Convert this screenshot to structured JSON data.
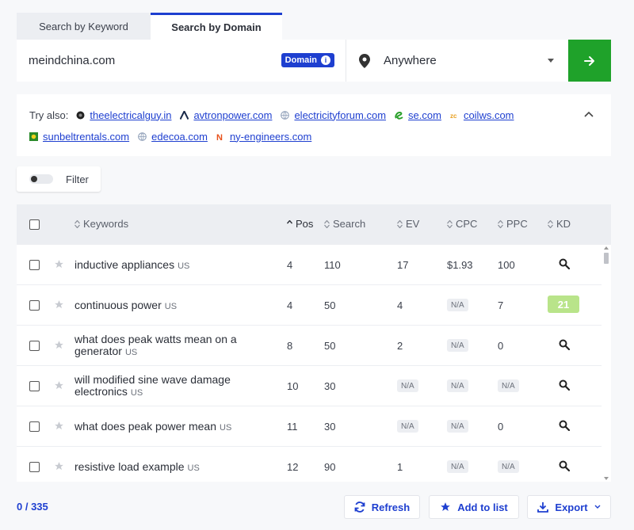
{
  "tabs": [
    {
      "label": "Search by Keyword",
      "active": false
    },
    {
      "label": "Search by Domain",
      "active": true
    }
  ],
  "search": {
    "domain_value": "meindchina.com",
    "badge_label": "Domain",
    "location_value": "Anywhere"
  },
  "try_also": {
    "label": "Try also:",
    "domains": [
      {
        "name": "theelectricalguy.in",
        "icon": "dark-globe-icon"
      },
      {
        "name": "avtronpower.com",
        "icon": "avtron-logo-icon"
      },
      {
        "name": "electricityforum.com",
        "icon": "globe-icon"
      },
      {
        "name": "se.com",
        "icon": "se-logo-icon"
      },
      {
        "name": "coilws.com",
        "icon": "coilws-logo-icon"
      },
      {
        "name": "sunbeltrentals.com",
        "icon": "sunbelt-logo-icon"
      },
      {
        "name": "edecoa.com",
        "icon": "globe-icon"
      },
      {
        "name": "ny-engineers.com",
        "icon": "ny-engineers-logo-icon"
      }
    ]
  },
  "filter": {
    "label": "Filter"
  },
  "table": {
    "headers": {
      "keywords": "Keywords",
      "pos": "Pos",
      "search": "Search",
      "ev": "EV",
      "cpc": "CPC",
      "ppc": "PPC",
      "kd": "KD"
    },
    "rows": [
      {
        "kw1": "inductive appliances",
        "kw2": "",
        "loc": "US",
        "pos": "4",
        "search": "110",
        "ev": "17",
        "cpc": "$1.93",
        "ppc": "100",
        "kd": ""
      },
      {
        "kw1": "continuous power",
        "kw2": "",
        "loc": "US",
        "pos": "4",
        "search": "50",
        "ev": "4",
        "cpc": "N/A",
        "ppc": "7",
        "kd": "21"
      },
      {
        "kw1": "what does peak watts mean on a",
        "kw2": "generator",
        "loc": "US",
        "pos": "8",
        "search": "50",
        "ev": "2",
        "cpc": "N/A",
        "ppc": "0",
        "kd": ""
      },
      {
        "kw1": "will modified sine wave damage",
        "kw2": "electronics",
        "loc": "US",
        "pos": "10",
        "search": "30",
        "ev": "N/A",
        "cpc": "N/A",
        "ppc": "N/A",
        "kd": ""
      },
      {
        "kw1": "what does peak power mean",
        "kw2": "",
        "loc": "US",
        "pos": "11",
        "search": "30",
        "ev": "N/A",
        "cpc": "N/A",
        "ppc": "0",
        "kd": ""
      },
      {
        "kw1": "resistive load example",
        "kw2": "",
        "loc": "US",
        "pos": "12",
        "search": "90",
        "ev": "1",
        "cpc": "N/A",
        "ppc": "N/A",
        "kd": ""
      }
    ]
  },
  "footer": {
    "count": "0 / 335",
    "refresh_label": "Refresh",
    "add_to_list_label": "Add to list",
    "export_label": "Export"
  },
  "colors": {
    "accent_blue": "#1e3fd0",
    "go_green": "#1fa22a",
    "kd_badge": "#b9e48a"
  }
}
